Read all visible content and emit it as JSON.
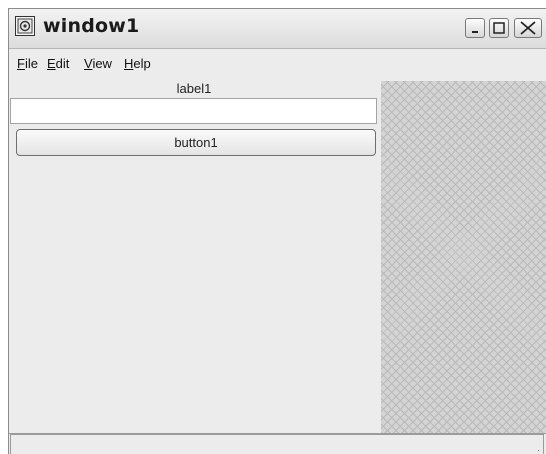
{
  "window": {
    "title": "window1"
  },
  "menubar": {
    "items": [
      {
        "key": "F",
        "rest": "ile"
      },
      {
        "key": "E",
        "rest": "dit"
      },
      {
        "key": "V",
        "rest": "iew"
      },
      {
        "key": "H",
        "rest": "elp"
      }
    ]
  },
  "left_pane": {
    "label": "label1",
    "entry_value": "",
    "button_label": "button1"
  },
  "statusbar": {
    "text": ""
  },
  "icons": [
    "app-icon",
    "minimize-icon",
    "maximize-icon",
    "close-icon",
    "resize-grip-icon"
  ],
  "colors": {
    "window_bg": "#ececec",
    "hatch": "#b9b9b9"
  }
}
